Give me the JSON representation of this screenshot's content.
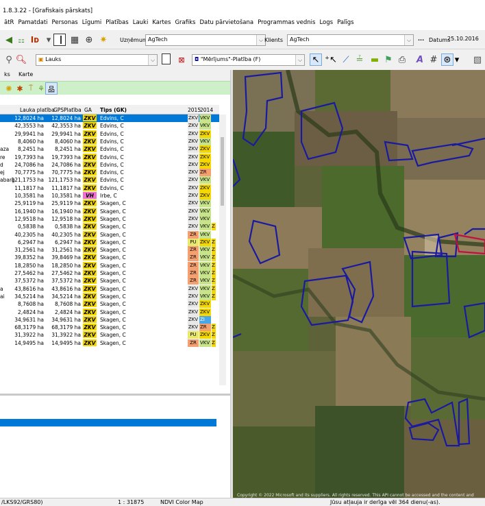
{
  "window": {
    "title": "1.8.3.22 - [Grafiskais pārskats]"
  },
  "menu": [
    "ātR",
    "Pamatdati",
    "Personas",
    "Līgumi",
    "Platības",
    "Lauki",
    "Kartes",
    "Grafiks",
    "Datu pārvietošana",
    "Programmas vednis",
    "Logs",
    "Palīgs"
  ],
  "toolbar1": {
    "uznemums_label": "Uzņēmums",
    "uznemums_value": "AgTech",
    "klients_label": "Klients",
    "klients_value": "AgTech",
    "datums_label": "Datums",
    "datums_value": "25.10.2016",
    "ellipsis": "..."
  },
  "toolbar2": {
    "layer_value": "Lauks",
    "measure_value": "\"Mērījums\"-Platība (F)"
  },
  "tabs": {
    "left": "ks",
    "karte": "Karte"
  },
  "grid": {
    "headers": {
      "area": "Lauka platība",
      "gps": "GPSPlatība",
      "ga": "GA",
      "tips": "Tips (GK)",
      "y2015": "2015",
      "y2014": "2014"
    },
    "rows": [
      {
        "name": "",
        "area": "12,8024 ha",
        "gps": "12,8024 ha",
        "ga": "ZKV",
        "tips": "Edvins, C",
        "y15": "ZKV",
        "y14": "VKV",
        "c13": "",
        "sel": true
      },
      {
        "name": "",
        "area": "42,3553 ha",
        "gps": "42,3553 ha",
        "ga": "ZKV",
        "tips": "Edvins, C",
        "y15": "ZKV",
        "y14": "VKV",
        "c13": ""
      },
      {
        "name": "",
        "area": "29,9941 ha",
        "gps": "29,9941 ha",
        "ga": "ZKV",
        "tips": "Edvins, C",
        "y15": "ZKV",
        "y14": "ZKV",
        "c13": ""
      },
      {
        "name": "",
        "area": "8,4060 ha",
        "gps": "8,4060 ha",
        "ga": "ZKV",
        "tips": "Edvins, C",
        "y15": "ZKV",
        "y14": "VKV",
        "c13": ""
      },
      {
        "name": "aza",
        "area": "8,2451 ha",
        "gps": "8,2451 ha",
        "ga": "ZKV",
        "tips": "Edvins, C",
        "y15": "ZKV",
        "y14": "ZKV",
        "c13": ""
      },
      {
        "name": "re",
        "area": "19,7393 ha",
        "gps": "19,7393 ha",
        "ga": "ZKV",
        "tips": "Edvins, C",
        "y15": "ZKV",
        "y14": "ZKV",
        "c13": ""
      },
      {
        "name": "d",
        "area": "24,7086 ha",
        "gps": "24,7086 ha",
        "ga": "ZKV",
        "tips": "Edvins, C",
        "y15": "ZKV",
        "y14": "ZKV",
        "c13": ""
      },
      {
        "name": "ej",
        "area": "70,7775 ha",
        "gps": "70,7775 ha",
        "ga": "ZKV",
        "tips": "Edvins, C",
        "y15": "ZKV",
        "y14": "ZR",
        "c13": ""
      },
      {
        "name": "abarg",
        "area": "121,1753 ha",
        "gps": "121,1753 ha",
        "ga": "ZKV",
        "tips": "Edvins, C",
        "y15": "ZKV",
        "y14": "VKV",
        "c13": ""
      },
      {
        "name": "",
        "area": "11,1817 ha",
        "gps": "11,1817 ha",
        "ga": "ZKV",
        "tips": "Edvins, C",
        "y15": "ZKV",
        "y14": "ZKV",
        "c13": ""
      },
      {
        "name": "",
        "area": "10,3581 ha",
        "gps": "10,3581 ha",
        "ga": "VH",
        "tips": "Irbe, C",
        "y15": "ZKV",
        "y14": "ZKV",
        "c13": ""
      },
      {
        "name": "",
        "area": "25,9119 ha",
        "gps": "25,9119 ha",
        "ga": "ZKV",
        "tips": "Skagen, C",
        "y15": "ZKV",
        "y14": "VKV",
        "c13": ""
      },
      {
        "name": "",
        "area": "16,1940 ha",
        "gps": "16,1940 ha",
        "ga": "ZKV",
        "tips": "Skagen, C",
        "y15": "ZKV",
        "y14": "VKV",
        "c13": ""
      },
      {
        "name": "",
        "area": "12,9518 ha",
        "gps": "12,9518 ha",
        "ga": "ZKV",
        "tips": "Skagen, C",
        "y15": "ZKV",
        "y14": "VKV",
        "c13": ""
      },
      {
        "name": "",
        "area": "0,5838 ha",
        "gps": "0,5838 ha",
        "ga": "ZKV",
        "tips": "Skagen, C",
        "y15": "ZKV",
        "y14": "VKV",
        "c13": "Z"
      },
      {
        "name": "",
        "area": "40,2305 ha",
        "gps": "40,2305 ha",
        "ga": "ZKV",
        "tips": "Skagen, C",
        "y15": "ZR",
        "y14": "VKV",
        "c13": ""
      },
      {
        "name": "",
        "area": "6,2947 ha",
        "gps": "6,2947 ha",
        "ga": "ZKV",
        "tips": "Skagen, C",
        "y15": "PU",
        "y14": "ZKV",
        "c13": "Z"
      },
      {
        "name": "",
        "area": "31,2561 ha",
        "gps": "31,2561 ha",
        "ga": "ZKV",
        "tips": "Skagen, C",
        "y15": "ZR",
        "y14": "VKV",
        "c13": "Z"
      },
      {
        "name": "",
        "area": "39,8352 ha",
        "gps": "39,8469 ha",
        "ga": "ZKV",
        "tips": "Skagen, C",
        "y15": "ZR",
        "y14": "VKV",
        "c13": "Z"
      },
      {
        "name": "",
        "area": "18,2850 ha",
        "gps": "18,2850 ha",
        "ga": "ZKV",
        "tips": "Skagen, C",
        "y15": "ZR",
        "y14": "VKV",
        "c13": "Z"
      },
      {
        "name": "",
        "area": "27,5462 ha",
        "gps": "27,5462 ha",
        "ga": "ZKV",
        "tips": "Skagen, C",
        "y15": "ZR",
        "y14": "VKV",
        "c13": "Z"
      },
      {
        "name": "",
        "area": "37,5372 ha",
        "gps": "37,5372 ha",
        "ga": "ZKV",
        "tips": "Skagen, C",
        "y15": "ZR",
        "y14": "VKV",
        "c13": "Z"
      },
      {
        "name": "a",
        "area": "43,8616 ha",
        "gps": "43,8616 ha",
        "ga": "ZKV",
        "tips": "Skagen, C",
        "y15": "ZKV",
        "y14": "VKV",
        "c13": "Z"
      },
      {
        "name": "ai",
        "area": "34,5214 ha",
        "gps": "34,5214 ha",
        "ga": "ZKV",
        "tips": "Skagen, C",
        "y15": "ZKV",
        "y14": "VKV",
        "c13": "Z"
      },
      {
        "name": "",
        "area": "8,7608 ha",
        "gps": "8,7608 ha",
        "ga": "ZKV",
        "tips": "Skagen, C",
        "y15": "ZKV",
        "y14": "ZKV",
        "c13": ""
      },
      {
        "name": "",
        "area": "2,4824 ha",
        "gps": "2,4824 ha",
        "ga": "ZKV",
        "tips": "Skagen, C",
        "y15": "ZKV",
        "y14": "ZKV",
        "c13": ""
      },
      {
        "name": "",
        "area": "34,9631 ha",
        "gps": "34,9631 ha",
        "ga": "ZKV",
        "tips": "Skagen, C",
        "y15": "ZKV",
        "y14": "ZI",
        "c13": ""
      },
      {
        "name": "",
        "area": "68,3179 ha",
        "gps": "68,3179 ha",
        "ga": "ZKV",
        "tips": "Skagen, C",
        "y15": "ZKV",
        "y14": "ZR",
        "c13": "Z"
      },
      {
        "name": "",
        "area": "31,3922 ha",
        "gps": "31,3922 ha",
        "ga": "ZKV",
        "tips": "Skagen, C",
        "y15": "PU",
        "y14": "ZKV",
        "c13": "Z"
      },
      {
        "name": "",
        "area": "14,9495 ha",
        "gps": "14,9495 ha",
        "ga": "ZKV",
        "tips": "Skagen, C",
        "y15": "ZR",
        "y14": "VKV",
        "c13": "Z"
      }
    ]
  },
  "map": {
    "copyright": "Copyright © 2022 Microsoft and its suppliers. All rights reserved. This API cannot be accessed and the content and"
  },
  "status": {
    "crs": "/LKS92/GRS80)",
    "scale": "1 : 31875",
    "layer": "NDVI Color Map",
    "license": "Jūsu atļauja ir derīga vēl 364 dienu(-as)."
  },
  "colors": {
    "ZKV": "#f5d800",
    "VKV": "#c8e48a",
    "ZR": "#f4a070",
    "PU": "#e8e870",
    "VH": "#f070d0",
    "ZI": "#4aa8e8",
    "row_ZKV": "#e8e8e8"
  }
}
